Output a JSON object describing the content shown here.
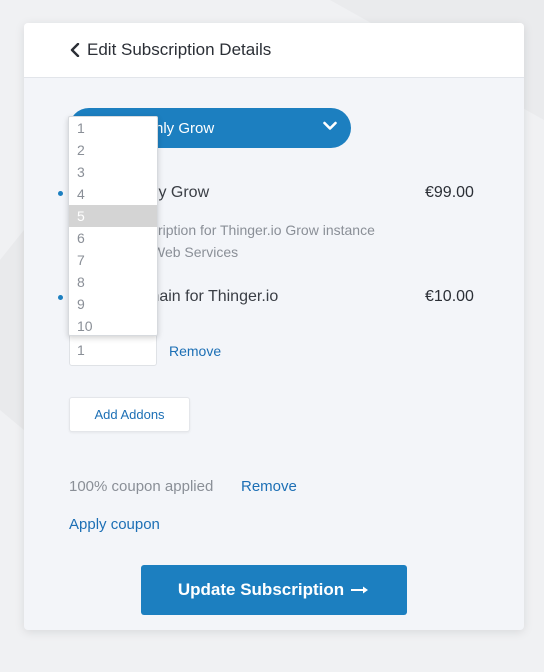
{
  "header": {
    "title": "Edit Subscription Details"
  },
  "plan_select": {
    "label": "hly Grow"
  },
  "items": [
    {
      "name": "hly Grow",
      "price": "€99.00",
      "desc_line1": "scription for Thinger.io Grow instance",
      "desc_line2": "Web Services"
    },
    {
      "name": "main for Thinger.io",
      "price": "€10.00"
    }
  ],
  "quantity": {
    "value": "1",
    "remove_label": "Remove"
  },
  "quantity_options": [
    "1",
    "2",
    "3",
    "4",
    "5",
    "6",
    "7",
    "8",
    "9",
    "10"
  ],
  "quantity_highlighted": "5",
  "addons": {
    "label": "Add Addons"
  },
  "coupon": {
    "status": "100% coupon applied",
    "remove_label": "Remove",
    "apply_label": "Apply coupon"
  },
  "update": {
    "label": "Update Subscription"
  },
  "colors": {
    "accent": "#1c7fc0",
    "link": "#1c6fb5",
    "muted": "#8a8f97"
  }
}
